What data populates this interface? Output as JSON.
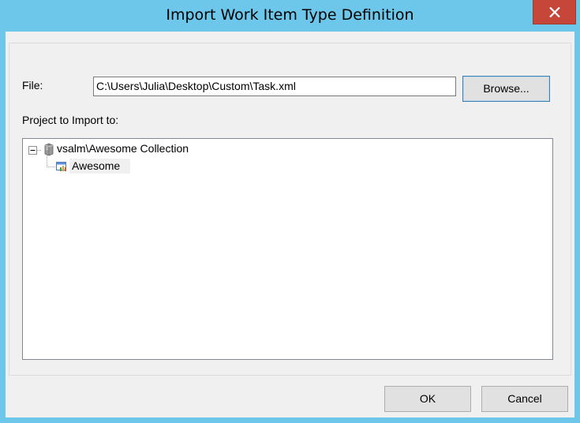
{
  "window": {
    "title": "Import Work Item Type Definition",
    "close_icon": "close-icon",
    "close_color": "#c7463a",
    "title_bar_color": "#6cc7ea"
  },
  "file": {
    "label": "File:",
    "value": "C:\\Users\\Julia\\Desktop\\Custom\\Task.xml",
    "browse_label": "Browse..."
  },
  "project": {
    "label": "Project to Import to:",
    "tree": {
      "root": {
        "label": "vsalm\\Awesome Collection",
        "icon": "server-icon",
        "expander": "collapse-minus-icon"
      },
      "children": [
        {
          "label": "Awesome",
          "icon": "team-project-icon",
          "selected": true
        }
      ]
    }
  },
  "buttons": {
    "ok_label": "OK",
    "cancel_label": "Cancel"
  }
}
